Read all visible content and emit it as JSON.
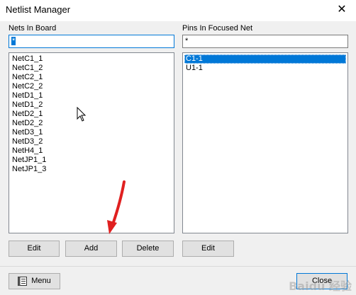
{
  "window": {
    "title": "Netlist Manager",
    "close_glyph": "✕"
  },
  "nets_panel": {
    "label": "Nets In Board",
    "filter_value": "*",
    "items": [
      "NetC1_1",
      "NetC1_2",
      "NetC2_1",
      "NetC2_2",
      "NetD1_1",
      "NetD1_2",
      "NetD2_1",
      "NetD2_2",
      "NetD3_1",
      "NetD3_2",
      "NetH4_1",
      "NetJP1_1",
      "NetJP1_3"
    ]
  },
  "pins_panel": {
    "label": "Pins In Focused Net",
    "filter_value": "*",
    "items": [
      "C1-1",
      "U1-1"
    ],
    "selected_index": 0
  },
  "buttons": {
    "nets_edit": "Edit",
    "nets_add": "Add",
    "nets_delete": "Delete",
    "pins_edit": "Edit",
    "menu": "Menu",
    "close": "Close"
  },
  "icons": {
    "menu": "menu-icon",
    "cursor": "mouse-pointer-icon",
    "annotation": "red-arrow-icon"
  },
  "colors": {
    "selection": "#0078d7",
    "annotation": "#e02020"
  },
  "watermark": "Baidu 经验"
}
